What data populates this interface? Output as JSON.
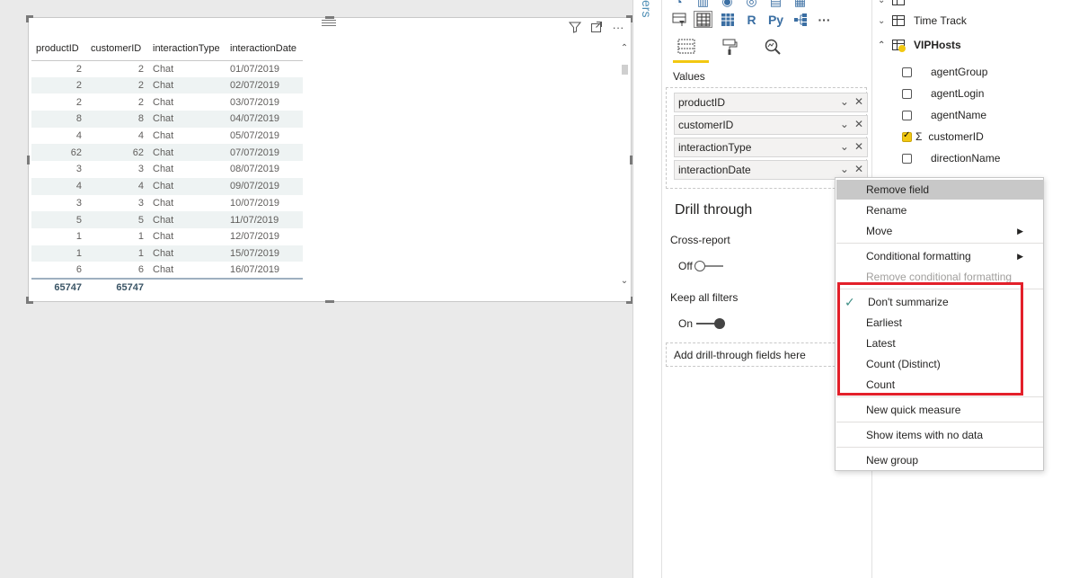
{
  "table": {
    "columns": [
      "productID",
      "customerID",
      "interactionType",
      "interactionDate"
    ],
    "rows": [
      [
        "2",
        "2",
        "Chat",
        "01/07/2019"
      ],
      [
        "2",
        "2",
        "Chat",
        "02/07/2019"
      ],
      [
        "2",
        "2",
        "Chat",
        "03/07/2019"
      ],
      [
        "8",
        "8",
        "Chat",
        "04/07/2019"
      ],
      [
        "4",
        "4",
        "Chat",
        "05/07/2019"
      ],
      [
        "62",
        "62",
        "Chat",
        "07/07/2019"
      ],
      [
        "3",
        "3",
        "Chat",
        "08/07/2019"
      ],
      [
        "4",
        "4",
        "Chat",
        "09/07/2019"
      ],
      [
        "3",
        "3",
        "Chat",
        "10/07/2019"
      ],
      [
        "5",
        "5",
        "Chat",
        "11/07/2019"
      ],
      [
        "1",
        "1",
        "Chat",
        "12/07/2019"
      ],
      [
        "1",
        "1",
        "Chat",
        "15/07/2019"
      ],
      [
        "6",
        "6",
        "Chat",
        "16/07/2019"
      ]
    ],
    "totals": [
      "65747",
      "65747",
      "",
      ""
    ]
  },
  "filters_strip": {
    "label": "ers"
  },
  "viz_pane": {
    "viz_icon_row_2": [
      "R",
      "Py"
    ],
    "viz_more": "···",
    "values_label": "Values",
    "wells": [
      "productID",
      "customerID",
      "interactionType",
      "interactionDate"
    ],
    "drill_title": "Drill through",
    "cross_report_label": "Cross-report",
    "cross_report_state": "Off",
    "keep_filters_label": "Keep all filters",
    "keep_filters_state": "On",
    "add_drill_placeholder": "Add drill-through fields here"
  },
  "fields_pane": {
    "tables": [
      {
        "name": "Time Track",
        "expanded": false
      },
      {
        "name": "VIPHosts",
        "expanded": true
      }
    ],
    "fields": [
      {
        "name": "agentGroup",
        "checked": false,
        "sigma": false
      },
      {
        "name": "agentLogin",
        "checked": false,
        "sigma": false
      },
      {
        "name": "agentName",
        "checked": false,
        "sigma": false
      },
      {
        "name": "customerID",
        "checked": true,
        "sigma": true
      },
      {
        "name": "directionName",
        "checked": false,
        "sigma": false
      }
    ]
  },
  "context_menu": {
    "remove_field": "Remove field",
    "rename": "Rename",
    "move": "Move",
    "conditional_formatting": "Conditional formatting",
    "remove_conditional_formatting": "Remove conditional formatting",
    "dont_summarize": "Don't summarize",
    "earliest": "Earliest",
    "latest": "Latest",
    "count_distinct": "Count (Distinct)",
    "count": "Count",
    "new_quick_measure": "New quick measure",
    "show_items_no_data": "Show items with no data",
    "new_group": "New group"
  },
  "colors": {
    "accent_yellow": "#f2c811",
    "highlight_red": "#e3202a",
    "check_teal": "#3f8f85",
    "row_alt": "#eef3f3"
  }
}
